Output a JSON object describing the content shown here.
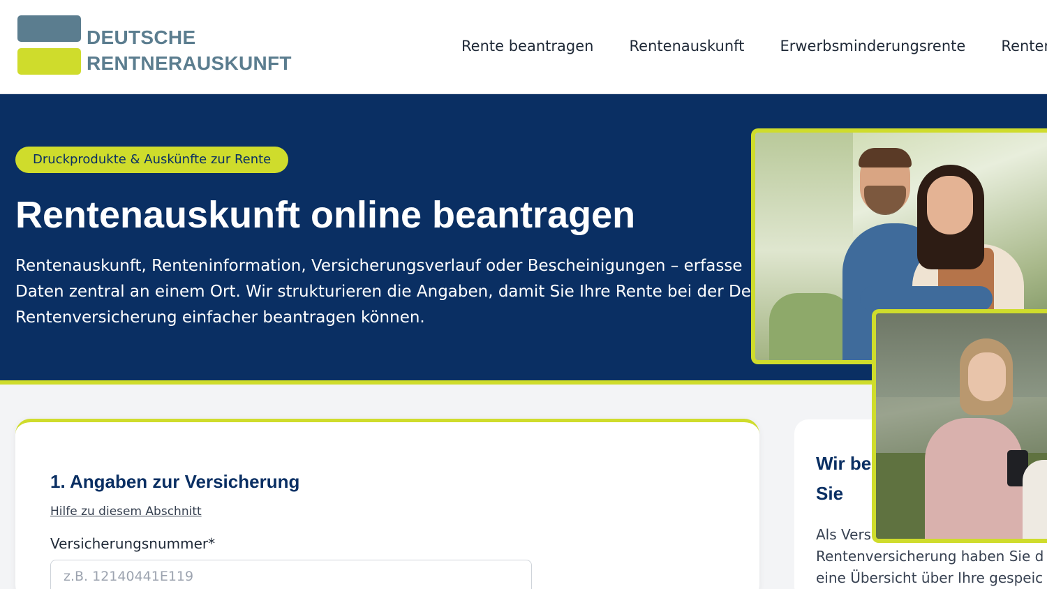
{
  "logo": {
    "line1": "DEUTSCHE",
    "line2": "RENTNERAUSKUNFT"
  },
  "nav": {
    "items": [
      "Rente beantragen",
      "Rentenauskunft",
      "Erwerbsminderungsrente",
      "Renten"
    ]
  },
  "hero": {
    "badge": "Druckprodukte & Auskünfte zur Rente",
    "title": "Rentenauskunft online beantragen",
    "text_lines": [
      "Rentenauskunft, Renteninformation, Versicherungsverlauf oder Bescheinigungen – erfasse",
      "Daten zentral an einem Ort. Wir strukturieren die Angaben, damit Sie Ihre Rente bei der De",
      "Rentenversicherung einfacher beantragen können."
    ]
  },
  "form": {
    "section_title": "1. Angaben zur Versicherung",
    "help_link": "Hilfe zu diesem Abschnitt",
    "field_label": "Versicherungsnummer*",
    "field_placeholder": "z.B. 12140441E119",
    "field_value": ""
  },
  "side": {
    "title_lines": [
      "Wir be",
      "Sie"
    ],
    "text_lines": [
      "Als Vers",
      "Rentenversicherung haben Sie d",
      "eine Übersicht über Ihre gespeic"
    ]
  },
  "colors": {
    "brand_navy": "#0a2f63",
    "brand_lime": "#cfdc2c",
    "logo_slate": "#5b7d8f"
  }
}
